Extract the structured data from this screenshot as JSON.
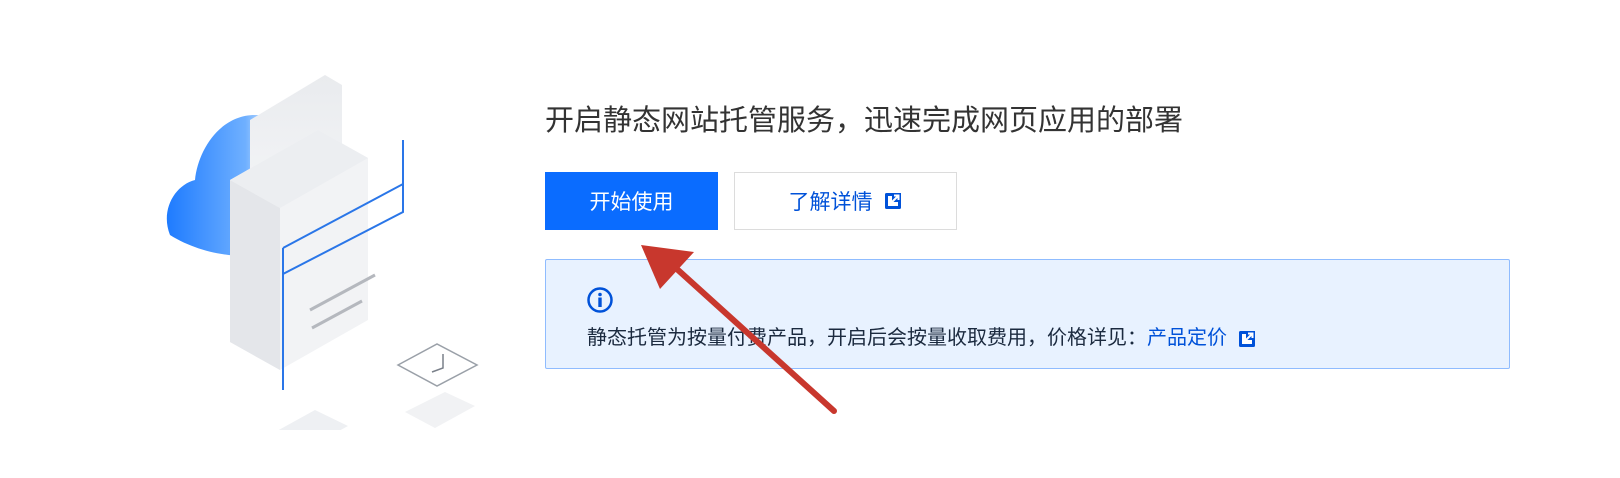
{
  "headline": "开启静态网站托管服务，迅速完成网页应用的部署",
  "buttons": {
    "start_label": "开始使用",
    "details_label": "了解详情"
  },
  "notice": {
    "text": "静态托管为按量付费产品，开启后会按量收取费用，价格详见：",
    "link_label": "产品定价"
  },
  "icons": {
    "illustration": "cloud-server-illustration",
    "external_link": "external-link-icon",
    "info": "info-icon",
    "annotation": "red-arrow-annotation"
  },
  "colors": {
    "primary": "#0A6CFF",
    "link": "#0052D9",
    "notice_bg": "#E8F2FF",
    "notice_border": "#8FBCFF",
    "arrow": "#C8372D"
  }
}
